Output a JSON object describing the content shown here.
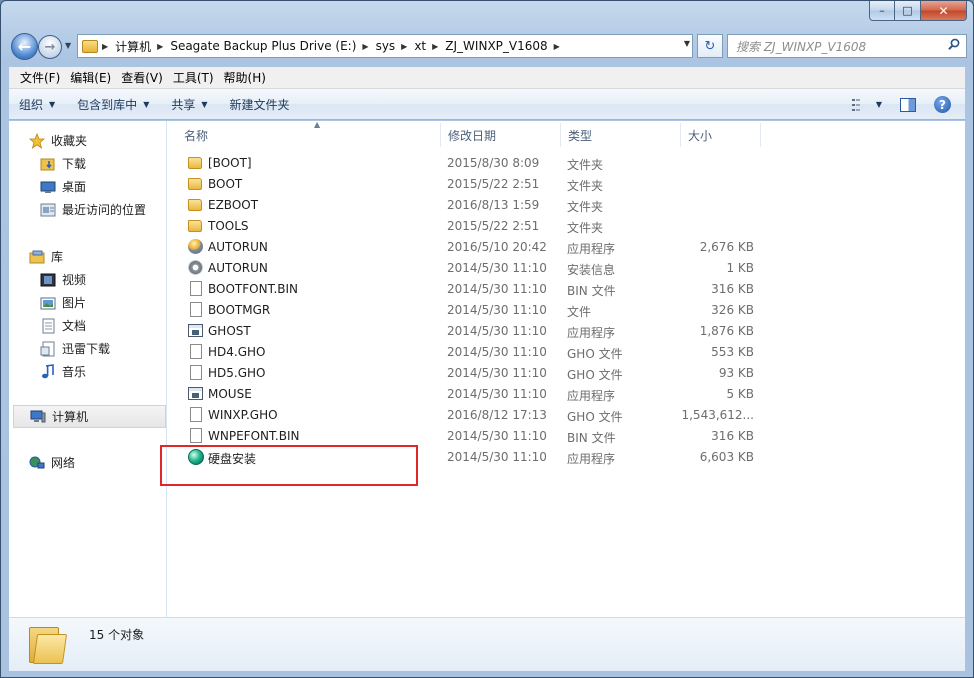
{
  "breadcrumbs": [
    "计算机",
    "Seagate Backup Plus Drive (E:)",
    "sys",
    "xt",
    "ZJ_WINXP_V1608"
  ],
  "search": {
    "placeholder": "搜索 ZJ_WINXP_V1608"
  },
  "menu": [
    "文件(F)",
    "编辑(E)",
    "查看(V)",
    "工具(T)",
    "帮助(H)"
  ],
  "commands": {
    "organize": "组织",
    "include_library": "包含到库中",
    "share": "共享",
    "new_folder": "新建文件夹"
  },
  "sidebar": {
    "favorites": {
      "label": "收藏夹",
      "items": [
        "下载",
        "桌面",
        "最近访问的位置"
      ]
    },
    "libraries": {
      "label": "库",
      "items": [
        "视频",
        "图片",
        "文档",
        "迅雷下载",
        "音乐"
      ]
    },
    "computer": "计算机",
    "network": "网络"
  },
  "columns": {
    "name": "名称",
    "date": "修改日期",
    "type": "类型",
    "size": "大小"
  },
  "files": [
    {
      "name": "[BOOT]",
      "date": "2015/8/30 8:09",
      "type": "文件夹",
      "size": "",
      "icon": "folder-icon"
    },
    {
      "name": "BOOT",
      "date": "2015/5/22 2:51",
      "type": "文件夹",
      "size": "",
      "icon": "folder-icon"
    },
    {
      "name": "EZBOOT",
      "date": "2016/8/13 1:59",
      "type": "文件夹",
      "size": "",
      "icon": "folder-icon"
    },
    {
      "name": "TOOLS",
      "date": "2015/5/22 2:51",
      "type": "文件夹",
      "size": "",
      "icon": "folder-icon"
    },
    {
      "name": "AUTORUN",
      "date": "2016/5/10 20:42",
      "type": "应用程序",
      "size": "2,676 KB",
      "icon": "setup-icon"
    },
    {
      "name": "AUTORUN",
      "date": "2014/5/30 11:10",
      "type": "安装信息",
      "size": "1 KB",
      "icon": "gear-file-icon"
    },
    {
      "name": "BOOTFONT.BIN",
      "date": "2014/5/30 11:10",
      "type": "BIN 文件",
      "size": "316 KB",
      "icon": "file-icon"
    },
    {
      "name": "BOOTMGR",
      "date": "2014/5/30 11:10",
      "type": "文件",
      "size": "326 KB",
      "icon": "file-icon"
    },
    {
      "name": "GHOST",
      "date": "2014/5/30 11:10",
      "type": "应用程序",
      "size": "1,876 KB",
      "icon": "application-icon"
    },
    {
      "name": "HD4.GHO",
      "date": "2014/5/30 11:10",
      "type": "GHO 文件",
      "size": "553 KB",
      "icon": "file-icon"
    },
    {
      "name": "HD5.GHO",
      "date": "2014/5/30 11:10",
      "type": "GHO 文件",
      "size": "93 KB",
      "icon": "file-icon"
    },
    {
      "name": "MOUSE",
      "date": "2014/5/30 11:10",
      "type": "应用程序",
      "size": "5 KB",
      "icon": "application-icon"
    },
    {
      "name": "WINXP.GHO",
      "date": "2016/8/12 17:13",
      "type": "GHO 文件",
      "size": "1,543,612...",
      "icon": "file-icon"
    },
    {
      "name": "WNPEFONT.BIN",
      "date": "2014/5/30 11:10",
      "type": "BIN 文件",
      "size": "316 KB",
      "icon": "file-icon"
    },
    {
      "name": "硬盘安装",
      "date": "2014/5/30 11:10",
      "type": "应用程序",
      "size": "6,603 KB",
      "icon": "disk-installer-icon"
    }
  ],
  "status": {
    "text": "15 个对象"
  },
  "colors": {
    "highlight": "#e0282a",
    "accent": "#1e395b"
  }
}
